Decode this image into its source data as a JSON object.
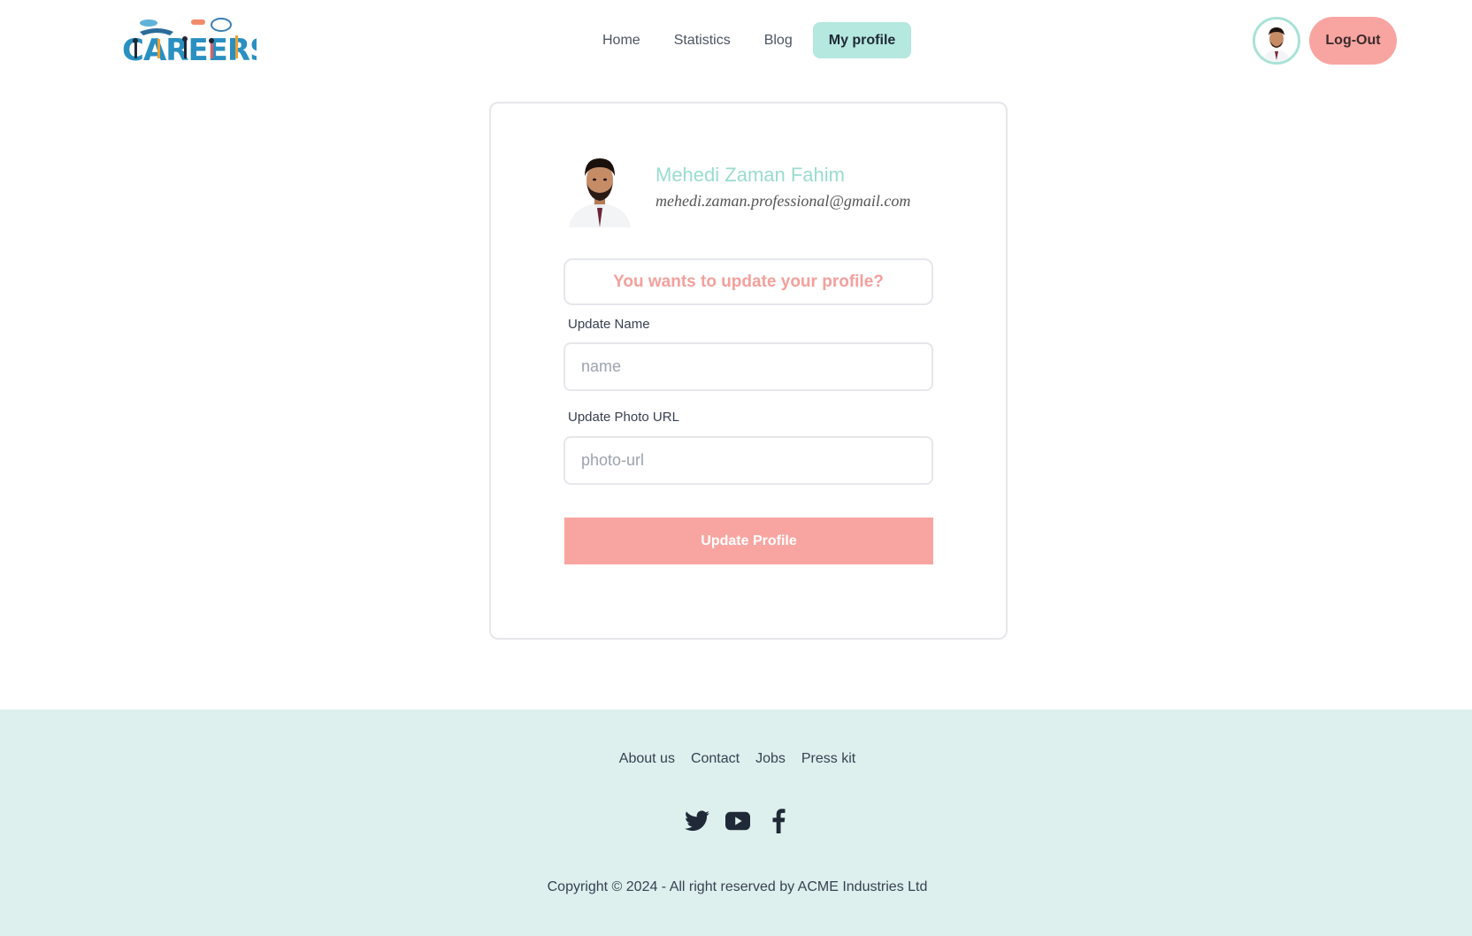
{
  "navbar": {
    "logo_alt": "CAREERS",
    "links": [
      {
        "label": "Home"
      },
      {
        "label": "Statistics"
      },
      {
        "label": "Blog"
      },
      {
        "label": "My profile",
        "active": true
      }
    ],
    "logout_label": "Log-Out"
  },
  "profile": {
    "name": "Mehedi Zaman Fahim",
    "email": "mehedi.zaman.professional@gmail.com"
  },
  "form": {
    "question": "You wants to update your profile?",
    "name_label": "Update Name",
    "name_placeholder": "name",
    "photo_label": "Update Photo URL",
    "photo_placeholder": "photo-url",
    "submit_label": "Update Profile"
  },
  "footer": {
    "links": [
      {
        "label": "About us"
      },
      {
        "label": "Contact"
      },
      {
        "label": "Jobs"
      },
      {
        "label": "Press kit"
      }
    ],
    "social": [
      "twitter-icon",
      "youtube-icon",
      "facebook-icon"
    ],
    "copyright": "Copyright © 2024 - All right reserved by ACME Industries Ltd"
  },
  "colors": {
    "accent_mint": "#b5e8de",
    "accent_pink": "#f8a5a2",
    "footer_bg": "#ddf0ee",
    "name_color": "#9adccf"
  }
}
